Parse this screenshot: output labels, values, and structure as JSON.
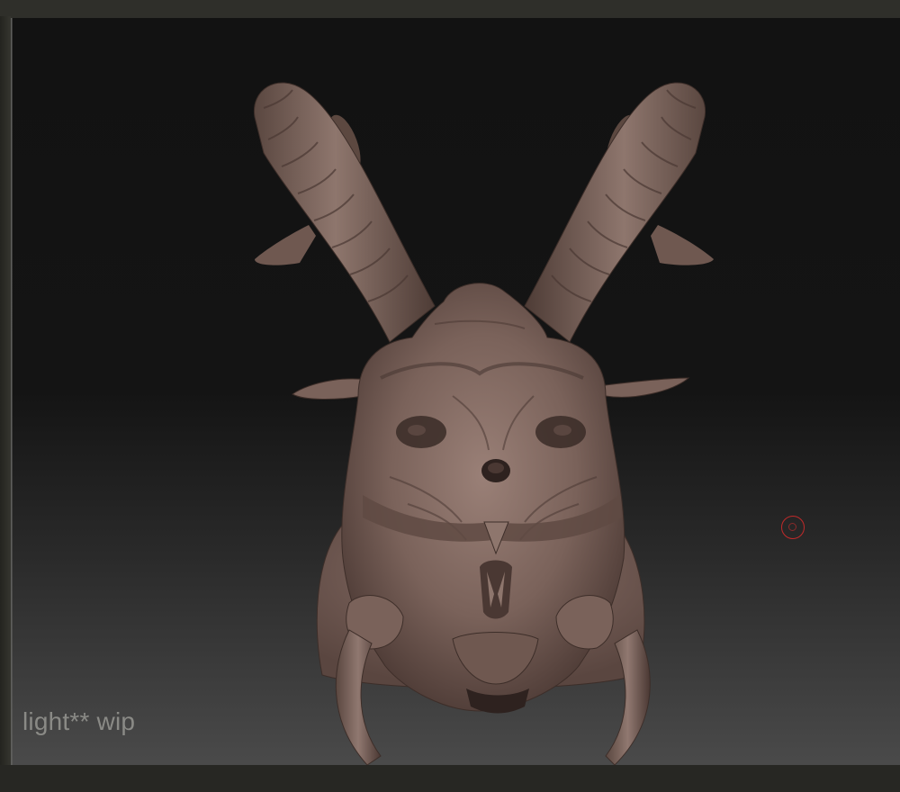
{
  "canvas": {
    "caption": "light** wip",
    "object": "demon-head-sculpt"
  },
  "colors": {
    "clay": "#7a625a",
    "clay_shadow": "#3d2e29",
    "clay_highlight": "#a08880",
    "background_top": "#121212",
    "background_bottom": "#4a4a4a",
    "cursor": "#c02a2a"
  },
  "icons": {
    "brush_cursor": "brush-cursor-icon"
  }
}
